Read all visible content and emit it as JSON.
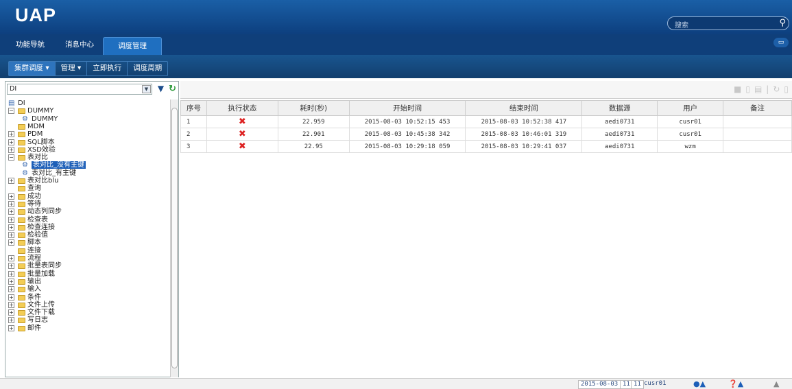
{
  "app": {
    "logo": "UAP",
    "search_placeholder": "搜索"
  },
  "nav": {
    "tabs": [
      "功能导航",
      "消息中心"
    ],
    "active_tab": "调度管理"
  },
  "toolbar": {
    "cluster": "集群调度 ▾",
    "manage": "管理 ▾",
    "run_now": "立即执行",
    "period": "调度周期"
  },
  "filter": {
    "value": "DI"
  },
  "tree": [
    {
      "label": "DI",
      "depth": 0,
      "kind": "root"
    },
    {
      "label": "DUMMY",
      "depth": 1,
      "kind": "folder",
      "toggle": "minus"
    },
    {
      "label": "DUMMY",
      "depth": 2,
      "kind": "leaf"
    },
    {
      "label": "MDM",
      "depth": 1,
      "kind": "folder",
      "toggle": ""
    },
    {
      "label": "PDM",
      "depth": 1,
      "kind": "folder",
      "toggle": "plus"
    },
    {
      "label": "SQL脚本",
      "depth": 1,
      "kind": "folder",
      "toggle": "plus"
    },
    {
      "label": "XSD效验",
      "depth": 1,
      "kind": "folder",
      "toggle": "plus"
    },
    {
      "label": "表对比",
      "depth": 1,
      "kind": "folder",
      "toggle": "minus"
    },
    {
      "label": "表对比_没有主键",
      "depth": 2,
      "kind": "leaf",
      "selected": true
    },
    {
      "label": "表对比_有主键",
      "depth": 2,
      "kind": "leaf"
    },
    {
      "label": "表对比blu",
      "depth": 1,
      "kind": "folder",
      "toggle": "plus"
    },
    {
      "label": "查询",
      "depth": 1,
      "kind": "folder",
      "toggle": ""
    },
    {
      "label": "成功",
      "depth": 1,
      "kind": "folder",
      "toggle": "plus"
    },
    {
      "label": "等待",
      "depth": 1,
      "kind": "folder",
      "toggle": "plus"
    },
    {
      "label": "动态列同步",
      "depth": 1,
      "kind": "folder",
      "toggle": "plus"
    },
    {
      "label": "检查表",
      "depth": 1,
      "kind": "folder",
      "toggle": "plus"
    },
    {
      "label": "检查连接",
      "depth": 1,
      "kind": "folder",
      "toggle": "plus"
    },
    {
      "label": "检验值",
      "depth": 1,
      "kind": "folder",
      "toggle": "plus"
    },
    {
      "label": "脚本",
      "depth": 1,
      "kind": "folder",
      "toggle": "plus"
    },
    {
      "label": "连接",
      "depth": 1,
      "kind": "folder",
      "toggle": ""
    },
    {
      "label": "流程",
      "depth": 1,
      "kind": "folder",
      "toggle": "plus"
    },
    {
      "label": "批量表同步",
      "depth": 1,
      "kind": "folder",
      "toggle": "plus"
    },
    {
      "label": "批量加载",
      "depth": 1,
      "kind": "folder",
      "toggle": "plus"
    },
    {
      "label": "输出",
      "depth": 1,
      "kind": "folder",
      "toggle": "plus"
    },
    {
      "label": "输入",
      "depth": 1,
      "kind": "folder",
      "toggle": "plus"
    },
    {
      "label": "条件",
      "depth": 1,
      "kind": "folder",
      "toggle": "plus"
    },
    {
      "label": "文件上传",
      "depth": 1,
      "kind": "folder",
      "toggle": "plus"
    },
    {
      "label": "文件下载",
      "depth": 1,
      "kind": "folder",
      "toggle": "plus"
    },
    {
      "label": "写日志",
      "depth": 1,
      "kind": "folder",
      "toggle": "plus"
    },
    {
      "label": "邮件",
      "depth": 1,
      "kind": "folder",
      "toggle": "plus"
    }
  ],
  "table": {
    "headers": [
      "序号",
      "执行状态",
      "耗时(秒)",
      "开始时间",
      "结束时间",
      "数据源",
      "用户",
      "备注"
    ],
    "rows": [
      [
        "1",
        "✖",
        "22.959",
        "2015-08-03 10:52:15 453",
        "2015-08-03 10:52:38 417",
        "aedi0731",
        "cusr01",
        ""
      ],
      [
        "2",
        "✖",
        "22.901",
        "2015-08-03 10:45:38 342",
        "2015-08-03 10:46:01 319",
        "aedi0731",
        "cusr01",
        ""
      ],
      [
        "3",
        "✖",
        "22.95",
        "2015-08-03 10:29:18 059",
        "2015-08-03 10:29:41 037",
        "aedi0731",
        "wzm",
        ""
      ]
    ]
  },
  "status": {
    "date": "2015-08-03",
    "a": "11",
    "b": "11",
    "user": "cusr01"
  }
}
